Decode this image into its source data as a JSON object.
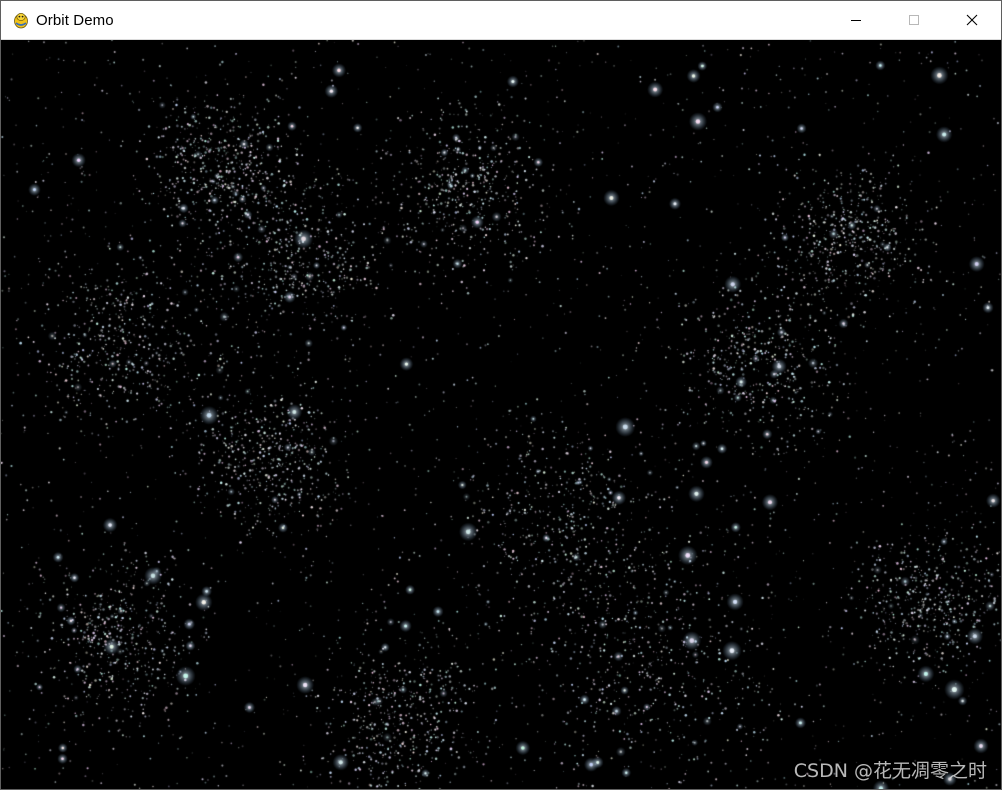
{
  "window": {
    "title": "Orbit Demo",
    "app_icon": "pygame-snake-icon",
    "controls": [
      "minimize-icon",
      "maximize-icon",
      "close-icon"
    ]
  },
  "scene": {
    "background_color": "#000000",
    "star_color": "#cfe0ef",
    "bright_star_color": "#ffffff"
  },
  "watermark": {
    "text": "CSDN @花无凋零之时"
  }
}
